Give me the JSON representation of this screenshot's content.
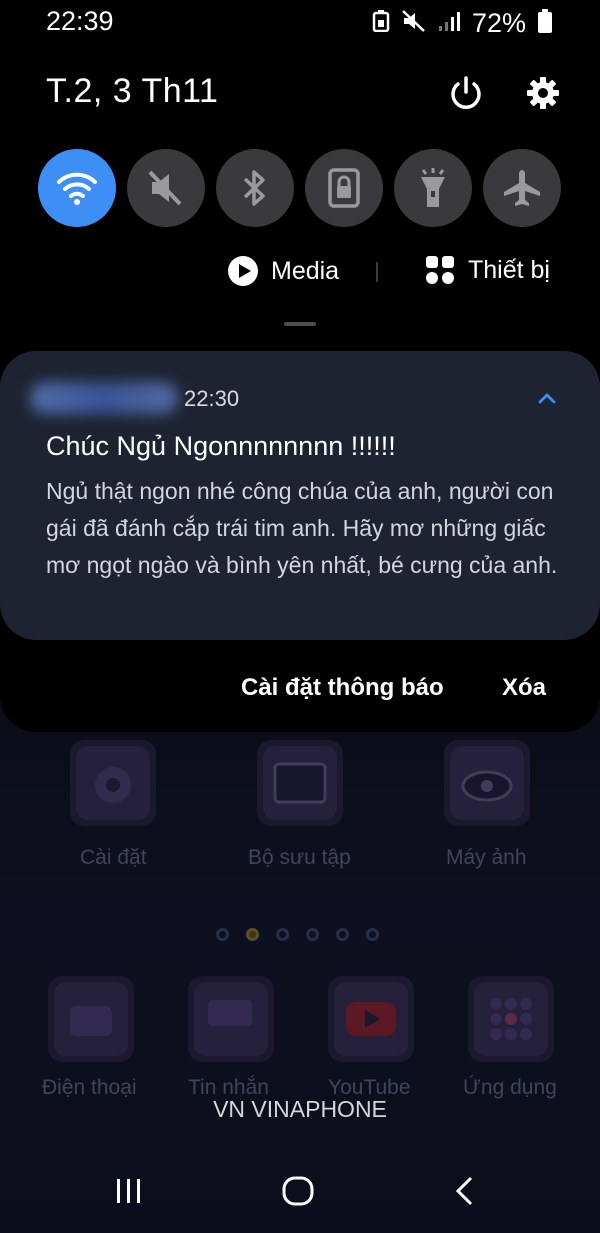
{
  "status_bar": {
    "time": "22:39",
    "battery": "72%"
  },
  "header": {
    "date": "T.2, 3 Th11"
  },
  "quick_toggles": [
    {
      "name": "wifi",
      "active": true
    },
    {
      "name": "sound-muted",
      "active": false
    },
    {
      "name": "bluetooth",
      "active": false
    },
    {
      "name": "screen-lock",
      "active": false
    },
    {
      "name": "flashlight",
      "active": false
    },
    {
      "name": "airplane",
      "active": false
    }
  ],
  "panel": {
    "media_label": "Media",
    "devices_label": "Thiết bị"
  },
  "notification": {
    "time": "22:30",
    "title": "Chúc Ngủ Ngonnnnnnnn !!!!!!",
    "body": "Ngủ thật ngon nhé công chúa của anh, người con gái đã đánh cắp trái tim anh. Hãy mơ những giấc mơ ngọt ngào và bình yên nhất, bé cưng của anh.",
    "settings_label": "Cài đặt thông báo",
    "clear_label": "Xóa"
  },
  "home_screen": {
    "row1": [
      "Cài đặt",
      "Bộ sưu tập",
      "Máy ảnh"
    ],
    "dock": [
      "Điện thoại",
      "Tin nhắn",
      "YouTube",
      "Ứng dụng"
    ],
    "carrier": "VN VINAPHONE"
  },
  "colors": {
    "accent": "#3d8ff5",
    "card": "#1d2331",
    "toggle_off": "#3a3a3c"
  }
}
